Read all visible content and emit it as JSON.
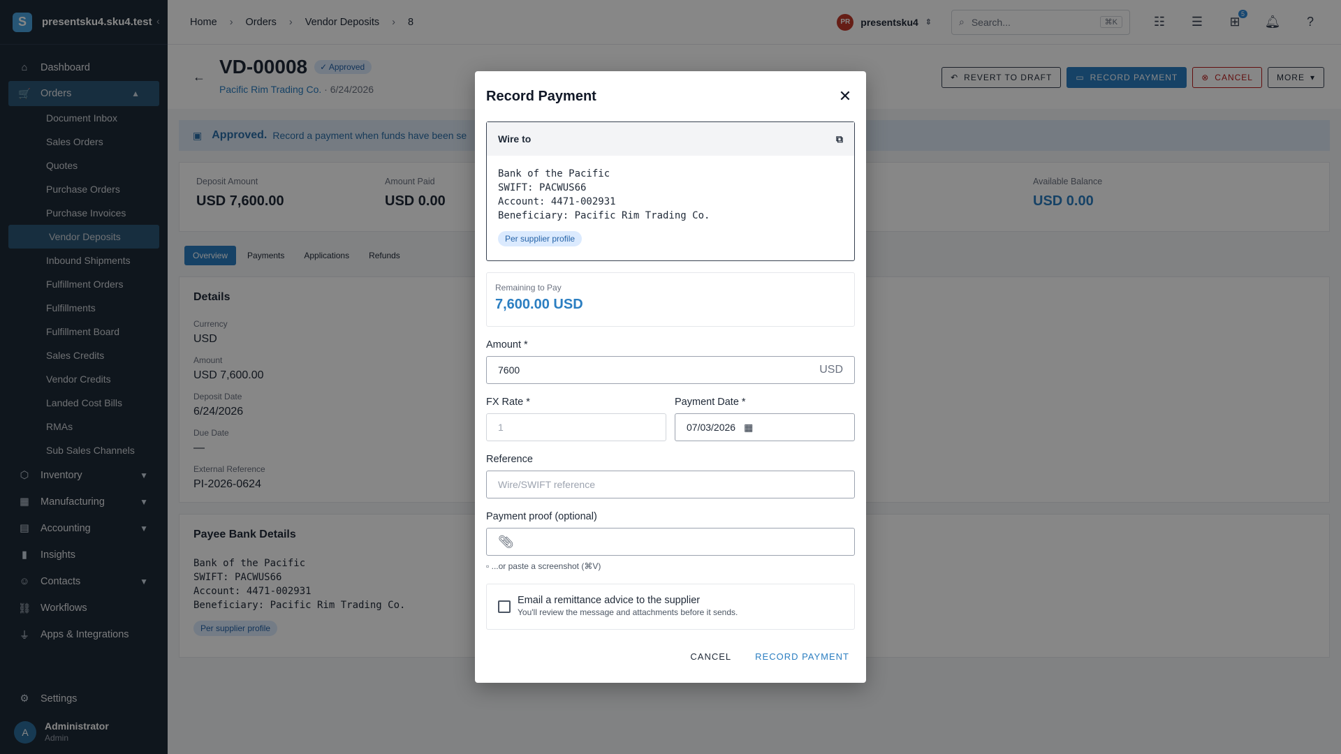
{
  "app": {
    "org": "presentsku4.sku4.test",
    "logo_letter": "S"
  },
  "sidebar": {
    "items": [
      {
        "label": "Dashboard"
      },
      {
        "label": "Orders"
      },
      {
        "label": "Inventory"
      },
      {
        "label": "Manufacturing"
      },
      {
        "label": "Accounting"
      },
      {
        "label": "Insights"
      },
      {
        "label": "Contacts"
      },
      {
        "label": "Workflows"
      },
      {
        "label": "Apps & Integrations"
      }
    ],
    "orders_sub": [
      "Document Inbox",
      "Sales Orders",
      "Quotes",
      "Purchase Orders",
      "Purchase Invoices",
      "Vendor Deposits",
      "Inbound Shipments",
      "Fulfillment Orders",
      "Fulfillments",
      "Fulfillment Board",
      "Sales Credits",
      "Vendor Credits",
      "Landed Cost Bills",
      "RMAs",
      "Sub Sales Channels"
    ],
    "settings": "Settings",
    "user": {
      "name": "Administrator",
      "role": "Admin",
      "initial": "A"
    }
  },
  "topbar": {
    "crumbs": [
      "Home",
      "Orders",
      "Vendor Deposits",
      "8"
    ],
    "org_initials": "PR",
    "org_name": "presentsku4",
    "search_placeholder": "Search...",
    "search_kbd": "⌘K",
    "gift_badge": "5"
  },
  "header": {
    "title": "VD-00008",
    "status": "Approved",
    "supplier": "Pacific Rim Trading Co.",
    "date": "6/24/2026",
    "actions": [
      "REVERT TO DRAFT",
      "RECORD PAYMENT",
      "CANCEL",
      "MORE"
    ]
  },
  "banner": {
    "title": "Approved.",
    "text": "Record a payment when funds have been se"
  },
  "kpis": [
    {
      "label": "Deposit Amount",
      "value": "USD 7,600.00"
    },
    {
      "label": "Amount Paid",
      "value": "USD 0.00"
    },
    {
      "label": "Available Balance",
      "value": "USD 0.00"
    }
  ],
  "tabs": [
    "Overview",
    "Payments",
    "Applications",
    "Refunds"
  ],
  "details": {
    "title": "Details",
    "fields": [
      {
        "label": "Currency",
        "value": "USD"
      },
      {
        "label": "Amount",
        "value": "USD 7,600.00"
      },
      {
        "label": "Deposit Date",
        "value": "6/24/2026"
      },
      {
        "label": "Due Date",
        "value": "—"
      },
      {
        "label": "External Reference",
        "value": "PI-2026-0624"
      }
    ]
  },
  "payee": {
    "title": "Payee Bank Details",
    "text": "Bank of the Pacific\nSWIFT: PACWUS66\nAccount: 4471-002931\nBeneficiary: Pacific Rim Trading Co.",
    "chip": "Per supplier profile"
  },
  "modal": {
    "title": "Record Payment",
    "wire_title": "Wire to",
    "wire_text": "Bank of the Pacific\nSWIFT: PACWUS66\nAccount: 4471-002931\nBeneficiary: Pacific Rim Trading Co.",
    "wire_chip": "Per supplier profile",
    "remaining_label": "Remaining to Pay",
    "remaining_value": "7,600.00 USD",
    "amount_label": "Amount *",
    "amount_value": "7600",
    "amount_suffix": "USD",
    "fx_label": "FX Rate *",
    "fx_value": "1",
    "date_label": "Payment Date *",
    "date_value": "07/03/2026",
    "ref_label": "Reference",
    "ref_placeholder": "Wire/SWIFT reference",
    "proof_label": "Payment proof (optional)",
    "paste_hint": "...or paste a screenshot (⌘V)",
    "email_label": "Email a remittance advice to the supplier",
    "email_sub": "You'll review the message and attachments before it sends.",
    "cancel": "CANCEL",
    "submit": "RECORD PAYMENT"
  }
}
